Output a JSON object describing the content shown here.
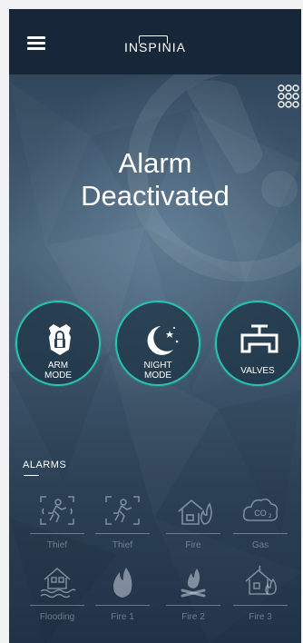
{
  "header": {
    "logo_text": "INSPINIA",
    "menu_icon": "hamburger-icon"
  },
  "top_right_button_icon": "grid-dots-icon",
  "status": {
    "line1": "Alarm",
    "line2": "Deactivated",
    "background_icon": "alert-icon"
  },
  "modes": [
    {
      "label_line1": "ARM",
      "label_line2": "MODE",
      "icon": "shield-lock-icon"
    },
    {
      "label_line1": "NIGHT",
      "label_line2": "MODE",
      "icon": "moon-stars-icon"
    },
    {
      "label_line1": "VALVES",
      "label_line2": "",
      "icon": "valve-icon"
    }
  ],
  "alarms": {
    "title": "ALARMS",
    "items": [
      {
        "label": "Thief",
        "icon": "thief-sensor-icon"
      },
      {
        "label": "Thief",
        "icon": "thief-sensor-icon"
      },
      {
        "label": "Fire",
        "icon": "house-fire-icon"
      },
      {
        "label": "Gas",
        "icon": "co2-cloud-icon"
      },
      {
        "label": "Flooding",
        "icon": "flooding-house-icon"
      },
      {
        "label": "Fire 1",
        "icon": "flame-icon"
      },
      {
        "label": "Fire 2",
        "icon": "campfire-icon"
      },
      {
        "label": "Fire 3",
        "icon": "burning-house-icon"
      }
    ]
  },
  "colors": {
    "accent": "#26c2b0",
    "header_bg": "#172739",
    "text": "#ffffff"
  }
}
